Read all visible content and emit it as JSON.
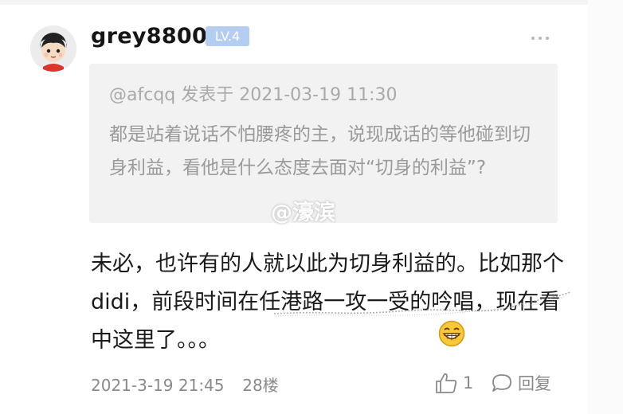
{
  "comment": {
    "username": "grey8800",
    "level_badge": "LV.4",
    "quote": {
      "meta": "@afcqq 发表于 2021-03-19 11:30",
      "text": "都是站着说话不怕腰疼的主，说现成话的等他碰到切身利益，看他是什么态度去面对“切身的利益”?"
    },
    "body": "未必，也许有的人就以此为切身利益的。比如那个didi，前段时间在任港路一攻一受的吟唱，现在看中这里了。。。",
    "timestamp": "2021-3-19 21:45",
    "floor": "28楼",
    "likes": "1",
    "reply_label": "回复"
  },
  "watermark": "@濠滨",
  "icons": {
    "avatar": "cartoon-girl-avatar",
    "more": "more-dots-icon",
    "emoji": "grinning-emoji-icon",
    "like": "thumbs-up-icon",
    "reply": "comment-bubble-icon"
  },
  "colors": {
    "badge_bg": "#b5cdf0",
    "quote_bg": "#f2f2f2",
    "meta_text": "#8a8a8a"
  }
}
